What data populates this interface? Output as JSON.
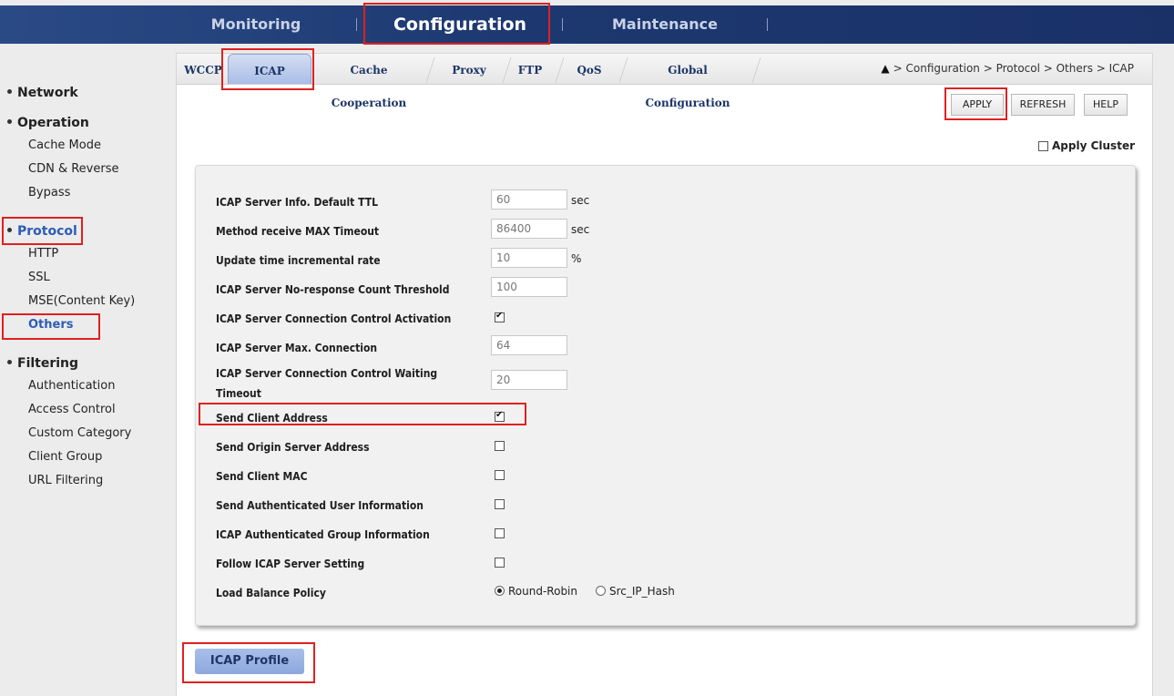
{
  "top_nav": {
    "items": [
      "Monitoring",
      "Configuration",
      "Maintenance"
    ],
    "active": "Configuration"
  },
  "sidebar": {
    "sections": [
      {
        "label": "Network",
        "items": []
      },
      {
        "label": "Operation",
        "items": [
          "Cache Mode",
          "CDN & Reverse",
          "Bypass"
        ]
      },
      {
        "label": "Protocol",
        "items": [
          "HTTP",
          "SSL",
          "MSE(Content Key)",
          "Others"
        ]
      },
      {
        "label": "Filtering",
        "items": [
          "Authentication",
          "Access Control",
          "Custom Category",
          "Client Group",
          "URL Filtering"
        ]
      }
    ],
    "active_section": "Protocol",
    "active_item": "Others"
  },
  "tabs": [
    "WCCP",
    "ICAP",
    "Cache Cooperation",
    "Proxy",
    "FTP",
    "QoS",
    "Global Configuration"
  ],
  "active_tab": "ICAP",
  "breadcrumb": "> Configuration > Protocol > Others > ICAP",
  "buttons": {
    "apply": "APPLY",
    "refresh": "REFRESH",
    "help": "HELP"
  },
  "apply_cluster": {
    "label": "Apply Cluster",
    "checked": false
  },
  "form": {
    "ttl": {
      "label": "ICAP Server Info. Default TTL",
      "value": "60",
      "unit": "sec"
    },
    "max_timeout": {
      "label": "Method receive MAX Timeout",
      "value": "86400",
      "unit": "sec"
    },
    "incremental_rate": {
      "label": "Update time incremental rate",
      "value": "10",
      "unit": "%"
    },
    "noresponse_threshold": {
      "label": "ICAP Server No-response Count Threshold",
      "value": "100"
    },
    "conn_control_activation": {
      "label": "ICAP Server Connection Control Activation",
      "checked": true
    },
    "max_connection": {
      "label": "ICAP Server Max. Connection",
      "value": "64"
    },
    "conn_control_waiting": {
      "label": "ICAP Server Connection Control Waiting Timeout",
      "value": "20"
    },
    "send_client_address": {
      "label": "Send Client Address",
      "checked": true
    },
    "send_origin_server": {
      "label": "Send Origin Server Address",
      "checked": false
    },
    "send_client_mac": {
      "label": "Send Client MAC",
      "checked": false
    },
    "send_auth_user": {
      "label": "Send Authenticated User Information",
      "checked": false
    },
    "auth_group": {
      "label": "ICAP Authenticated Group Information",
      "checked": false
    },
    "follow_server": {
      "label": "Follow ICAP Server Setting",
      "checked": false
    },
    "load_balance": {
      "label": "Load Balance Policy",
      "options": [
        "Round-Robin",
        "Src_IP_Hash"
      ],
      "selected": "Round-Robin"
    }
  },
  "icap_profile_button": "ICAP Profile",
  "colors": {
    "nav_bg": "#1d3870",
    "accent": "#2d5bb5",
    "highlight_red": "#e02020"
  }
}
